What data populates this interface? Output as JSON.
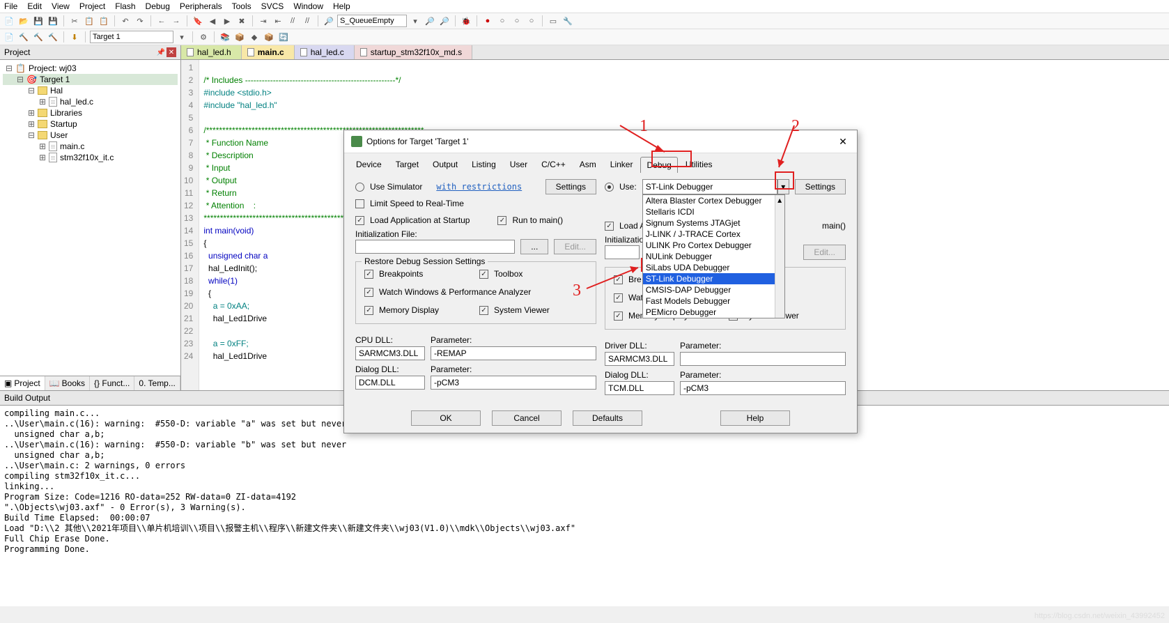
{
  "menubar": [
    "File",
    "Edit",
    "View",
    "Project",
    "Flash",
    "Debug",
    "Peripherals",
    "Tools",
    "SVCS",
    "Window",
    "Help"
  ],
  "toolbar2_combo": "S_QueueEmpty",
  "toolbar3_combo": "Target 1",
  "project_panel": {
    "title": "Project",
    "tree": {
      "root": "Project: wj03",
      "target": "Target 1",
      "groups": [
        {
          "name": "Hal",
          "files": [
            "hal_led.c"
          ],
          "expanded": true
        },
        {
          "name": "Libraries",
          "files": [],
          "expanded": false
        },
        {
          "name": "Startup",
          "files": [],
          "expanded": false
        },
        {
          "name": "User",
          "files": [
            "main.c",
            "stm32f10x_it.c"
          ],
          "expanded": true
        }
      ]
    },
    "bottom_tabs": [
      "Project",
      "Books",
      "{} Funct...",
      "0. Temp..."
    ]
  },
  "file_tabs": [
    {
      "label": "hal_led.h",
      "cls": "ft-h"
    },
    {
      "label": "main.c",
      "cls": "ft-c",
      "active": true
    },
    {
      "label": "hal_led.c",
      "cls": "ft-c2"
    },
    {
      "label": "startup_stm32f10x_md.s",
      "cls": "ft-s"
    }
  ],
  "code_lines": [
    {
      "n": 1,
      "t": ""
    },
    {
      "n": 2,
      "t": "/* Includes ------------------------------------------------------*/",
      "cls": "cmt"
    },
    {
      "n": 3,
      "t": "#include <stdio.h>",
      "cls": "pp"
    },
    {
      "n": 4,
      "t": "#include \"hal_led.h\"",
      "cls": "pp"
    },
    {
      "n": 5,
      "t": ""
    },
    {
      "n": 6,
      "t": "/*******************************************************************",
      "cls": "cmt"
    },
    {
      "n": 7,
      "t": " * Function Name",
      "cls": "cmt"
    },
    {
      "n": 8,
      "t": " * Description",
      "cls": "cmt"
    },
    {
      "n": 9,
      "t": " * Input",
      "cls": "cmt"
    },
    {
      "n": 10,
      "t": " * Output",
      "cls": "cmt"
    },
    {
      "n": 11,
      "t": " * Return",
      "cls": "cmt"
    },
    {
      "n": 12,
      "t": " * Attention    :",
      "cls": "cmt"
    },
    {
      "n": 13,
      "t": "*******************************************************************",
      "cls": "cmt"
    },
    {
      "n": 14,
      "t": "int main(void)",
      "cls": "kw"
    },
    {
      "n": 15,
      "t": "{"
    },
    {
      "n": 16,
      "t": "  unsigned char a",
      "cls": "kw"
    },
    {
      "n": 17,
      "t": "  hal_LedInit();"
    },
    {
      "n": 18,
      "t": "  while(1)",
      "cls": "kw"
    },
    {
      "n": 19,
      "t": "  {"
    },
    {
      "n": 20,
      "t": "    a = 0xAA;",
      "cls": "num"
    },
    {
      "n": 21,
      "t": "    hal_Led1Drive"
    },
    {
      "n": 22,
      "t": ""
    },
    {
      "n": 23,
      "t": "    a = 0xFF;",
      "cls": "num"
    },
    {
      "n": 24,
      "t": "    hal_Led1Drive"
    }
  ],
  "build_output": {
    "title": "Build Output",
    "text": "compiling main.c...\n..\\User\\main.c(16): warning:  #550-D: variable \"a\" was set but never\n  unsigned char a,b;\n..\\User\\main.c(16): warning:  #550-D: variable \"b\" was set but never\n  unsigned char a,b;\n..\\User\\main.c: 2 warnings, 0 errors\ncompiling stm32f10x_it.c...\nlinking...\nProgram Size: Code=1216 RO-data=252 RW-data=0 ZI-data=4192\n\".\\Objects\\wj03.axf\" - 0 Error(s), 3 Warning(s).\nBuild Time Elapsed:  00:00:07\nLoad \"D:\\\\2 其他\\\\2021年项目\\\\单片机培训\\\\项目\\\\报警主机\\\\程序\\\\新建文件夹\\\\新建文件夹\\\\wj03(V1.0)\\\\mdk\\\\Objects\\\\wj03.axf\"\nFull Chip Erase Done.\nProgramming Done."
  },
  "dialog": {
    "title": "Options for Target 'Target 1'",
    "tabs": [
      "Device",
      "Target",
      "Output",
      "Listing",
      "User",
      "C/C++",
      "Asm",
      "Linker",
      "Debug",
      "Utilities"
    ],
    "active_tab": "Debug",
    "left": {
      "use_simulator": "Use Simulator",
      "restrictions": "with restrictions",
      "settings": "Settings",
      "limit_speed": "Limit Speed to Real-Time",
      "load_app": "Load Application at Startup",
      "run_to_main": "Run to main()",
      "init_file": "Initialization File:",
      "edit": "Edit...",
      "restore_title": "Restore Debug Session Settings",
      "breakpoints": "Breakpoints",
      "toolbox": "Toolbox",
      "watch": "Watch Windows & Performance Analyzer",
      "memory": "Memory Display",
      "sysview": "System Viewer",
      "cpu_dll_label": "CPU DLL:",
      "cpu_dll": "SARMCM3.DLL",
      "param1_label": "Parameter:",
      "param1": "-REMAP",
      "dialog_dll_label": "Dialog DLL:",
      "dialog_dll": "DCM.DLL",
      "param2": "-pCM3"
    },
    "right": {
      "use": "Use:",
      "debugger": "ST-Link Debugger",
      "settings": "Settings",
      "load_app_short": "Load A",
      "main_short": "main()",
      "init_file": "Initializatio",
      "edit": "Edit...",
      "breakpoints": "Bre",
      "watch": "Watch Windows",
      "memory": "Memory Display",
      "sysview": "System Viewer",
      "driver_dll_label": "Driver DLL:",
      "driver_dll": "SARMCM3.DLL",
      "param1_label": "Parameter:",
      "param1": "",
      "dialog_dll_label": "Dialog DLL:",
      "dialog_dll": "TCM.DLL",
      "param2": "-pCM3"
    },
    "dropdown": [
      "Altera Blaster Cortex Debugger",
      "Stellaris ICDI",
      "Signum Systems JTAGjet",
      "J-LINK / J-TRACE Cortex",
      "ULINK Pro Cortex Debugger",
      "NULink Debugger",
      "SiLabs UDA Debugger",
      "ST-Link Debugger",
      "CMSIS-DAP Debugger",
      "Fast Models Debugger",
      "PEMicro Debugger"
    ],
    "dropdown_selected": "ST-Link Debugger",
    "footer": {
      "ok": "OK",
      "cancel": "Cancel",
      "defaults": "Defaults",
      "help": "Help"
    }
  },
  "annotations": {
    "n1": "1",
    "n2": "2",
    "n3": "3"
  },
  "watermark": "https://blog.csdn.net/weixin_43992452"
}
